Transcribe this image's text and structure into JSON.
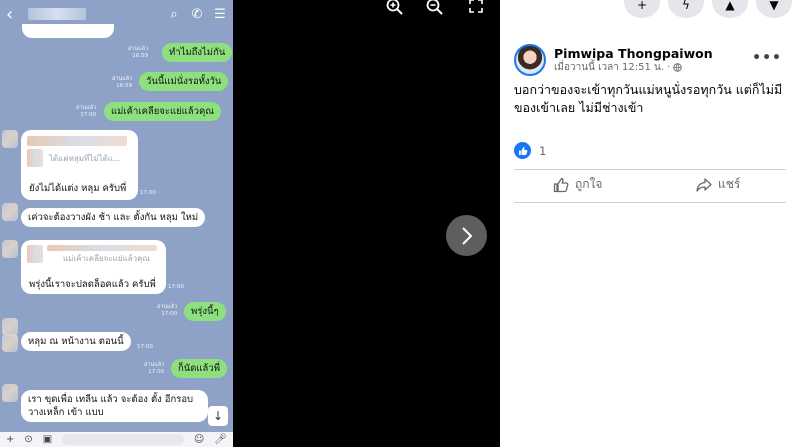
{
  "chat": {
    "messages": [
      {
        "dir": "out",
        "text": "ทำไมถึงไม่กัน",
        "status": "อ่านแล้ว",
        "time": "16:59"
      },
      {
        "dir": "out",
        "text": "วันนี้แม่นั่งรอทั้งวัน",
        "status": "อ่านแล้ว",
        "time": "16:59"
      },
      {
        "dir": "out",
        "text": "แม่เค้าเคลียจะแย่แล้วคุณ",
        "status": "อ่านแล้ว",
        "time": "17:00"
      },
      {
        "dir": "in",
        "quote": "ได้แต่หลุมที่ไม่ได้แ...",
        "text": "ยังไม่ได้แต่ง หลุม ครับพี่",
        "time": "17:00"
      },
      {
        "dir": "in",
        "text": "เค่วจะต้องวางผัง ช้า และ ตั้งกัน หลุม ใหม่",
        "time": "17:00"
      },
      {
        "dir": "in",
        "quote": "แม่เค้าเคลียจะแย่แล้วคุณ",
        "text": "พรุ่งนี้เราจะปลดล็อคแล้ว ครับพี่",
        "time": "17:00"
      },
      {
        "dir": "out",
        "text": "พรุ่งนี้ๆ",
        "status": "อ่านแล้ว",
        "time": "17:00"
      },
      {
        "dir": "in",
        "text": "หลุม ณ  หน้างาน ตอนนี้",
        "time": "17:00"
      },
      {
        "dir": "out",
        "text": "ก็นัดแล้วพี่",
        "status": "อ่านแล้ว",
        "time": "17:00"
      },
      {
        "dir": "in",
        "text": "เรา ขุดเพื่อ เทลีน แล้ว จะต้อง ตั้ง อีกรอบ",
        "text2": "วางเหล็ก เข้า แบบ",
        "time": "17:00"
      }
    ]
  },
  "viewer": {
    "zoom_in": "zoom-in",
    "zoom_out": "zoom-out",
    "fullscreen": "fullscreen"
  },
  "post": {
    "author": "Pimwipa Thongpaiwon",
    "time": "เมื่อวานนี้ เวลา 12:51 น.",
    "text": "บอกว่าของจะเข้าทุกวันแม่หนูนั่งรอทุกวัน แต่ก็ไม่มีของเข้าเลย ไม่มีช่างเข้า",
    "reaction_count": "1",
    "like_label": "ถูกใจ",
    "share_label": "แชร์"
  },
  "colors": {
    "chat_bg": "#8ea1c7",
    "outgoing_bubble": "#8ee07e",
    "facebook_blue": "#1877f2"
  }
}
